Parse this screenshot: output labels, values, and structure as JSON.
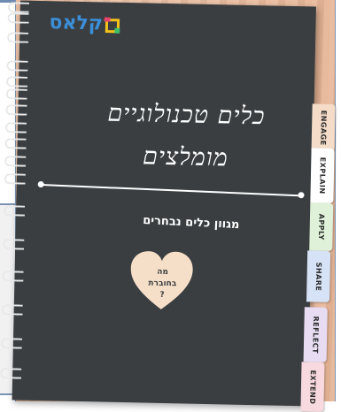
{
  "logo": {
    "text": "קלאס",
    "colors": {
      "text": "#3b8fd9",
      "mark_yellow": "#f4c21a",
      "mark_red": "#e8436d",
      "mark_green": "#3fbf6a"
    }
  },
  "cover": {
    "title_line1": "כלים טכנולוגיים",
    "title_line2": "מומלצים",
    "subtitle": "מגוון כלים נבחרים",
    "heart_line1": "מה",
    "heart_line2": "בחוברת",
    "heart_line3": "?",
    "background_color": "#3a3e41",
    "heart_color": "#f6dfc9"
  },
  "tabs": [
    {
      "label": "ENGAGE",
      "color": "#f4dcc8"
    },
    {
      "label": "EXPLAIN",
      "color": "#ffffff"
    },
    {
      "label": "APPLY",
      "color": "#dff1d8"
    },
    {
      "label": "SHARE",
      "color": "#d6e2f5"
    },
    {
      "label": "REFLECT",
      "color": "#e7dcf2"
    },
    {
      "label": "EXTEND",
      "color": "#f7d9df"
    }
  ]
}
